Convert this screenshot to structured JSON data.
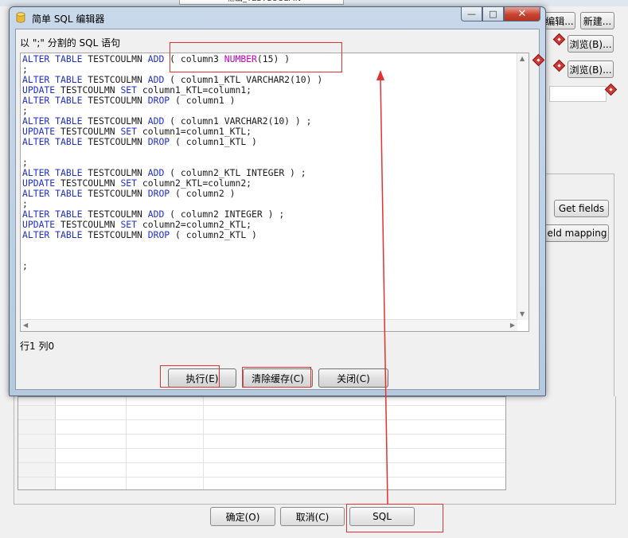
{
  "background": {
    "top_field": "输出_TESTCOULMN",
    "buttons": {
      "edit": "编辑...",
      "new": "新建...",
      "browse1": "浏览(B)...",
      "browse2": "浏览(B)...",
      "get_fields": "Get fields",
      "field_mapping": "eld mapping",
      "ok": "确定(O)",
      "cancel": "取消(C)",
      "sql": "SQL"
    }
  },
  "dialog": {
    "title": "简单 SQL 编辑器",
    "prompt": "以 \";\" 分割的 SQL 语句",
    "code_lines": [
      [
        {
          "t": "ALTER TABLE",
          "c": "kw"
        },
        {
          "t": " TESTCOULMN "
        },
        {
          "t": "ADD",
          "c": "kw"
        },
        {
          "t": " ( column3 "
        },
        {
          "t": "NUMBER",
          "c": "ty"
        },
        {
          "t": "(15) )"
        }
      ],
      [
        {
          "t": ";"
        }
      ],
      [
        {
          "t": "ALTER TABLE",
          "c": "kw"
        },
        {
          "t": " TESTCOULMN "
        },
        {
          "t": "ADD",
          "c": "kw"
        },
        {
          "t": " ( column1_KTL VARCHAR2(10) )"
        }
      ],
      [
        {
          "t": "UPDATE",
          "c": "kw"
        },
        {
          "t": " TESTCOULMN "
        },
        {
          "t": "SET",
          "c": "kw"
        },
        {
          "t": " column1_KTL=column1;"
        }
      ],
      [
        {
          "t": "ALTER TABLE",
          "c": "kw"
        },
        {
          "t": " TESTCOULMN "
        },
        {
          "t": "DROP",
          "c": "kw"
        },
        {
          "t": " ( column1 )"
        }
      ],
      [
        {
          "t": ";"
        }
      ],
      [
        {
          "t": "ALTER TABLE",
          "c": "kw"
        },
        {
          "t": " TESTCOULMN "
        },
        {
          "t": "ADD",
          "c": "kw"
        },
        {
          "t": " ( column1 VARCHAR2(10) ) ;"
        }
      ],
      [
        {
          "t": "UPDATE",
          "c": "kw"
        },
        {
          "t": " TESTCOULMN "
        },
        {
          "t": "SET",
          "c": "kw"
        },
        {
          "t": " column1=column1_KTL;"
        }
      ],
      [
        {
          "t": "ALTER TABLE",
          "c": "kw"
        },
        {
          "t": " TESTCOULMN "
        },
        {
          "t": "DROP",
          "c": "kw"
        },
        {
          "t": " ( column1_KTL )"
        }
      ],
      [
        {
          "t": ""
        }
      ],
      [
        {
          "t": ";"
        }
      ],
      [
        {
          "t": "ALTER TABLE",
          "c": "kw"
        },
        {
          "t": " TESTCOULMN "
        },
        {
          "t": "ADD",
          "c": "kw"
        },
        {
          "t": " ( column2_KTL INTEGER ) ;"
        }
      ],
      [
        {
          "t": "UPDATE",
          "c": "kw"
        },
        {
          "t": " TESTCOULMN "
        },
        {
          "t": "SET",
          "c": "kw"
        },
        {
          "t": " column2_KTL=column2;"
        }
      ],
      [
        {
          "t": "ALTER TABLE",
          "c": "kw"
        },
        {
          "t": " TESTCOULMN "
        },
        {
          "t": "DROP",
          "c": "kw"
        },
        {
          "t": " ( column2 )"
        }
      ],
      [
        {
          "t": ";"
        }
      ],
      [
        {
          "t": "ALTER TABLE",
          "c": "kw"
        },
        {
          "t": " TESTCOULMN "
        },
        {
          "t": "ADD",
          "c": "kw"
        },
        {
          "t": " ( column2 INTEGER ) ;"
        }
      ],
      [
        {
          "t": "UPDATE",
          "c": "kw"
        },
        {
          "t": " TESTCOULMN "
        },
        {
          "t": "SET",
          "c": "kw"
        },
        {
          "t": " column2=column2_KTL;"
        }
      ],
      [
        {
          "t": "ALTER TABLE",
          "c": "kw"
        },
        {
          "t": " TESTCOULMN "
        },
        {
          "t": "DROP",
          "c": "kw"
        },
        {
          "t": " ( column2_KTL )"
        }
      ],
      [
        {
          "t": ""
        }
      ],
      [
        {
          "t": ""
        }
      ],
      [
        {
          "t": ";"
        }
      ]
    ],
    "status": "行1 列0",
    "buttons": {
      "execute": "执行(E)",
      "clear_cache": "清除缓存(C)",
      "close": "关闭(C)"
    },
    "window_buttons": {
      "minimize": "—",
      "maximize": "□",
      "close": "✕"
    }
  },
  "colors": {
    "keyword": "#1f2fc8",
    "type": "#c000c0",
    "annotation": "#e23232"
  }
}
